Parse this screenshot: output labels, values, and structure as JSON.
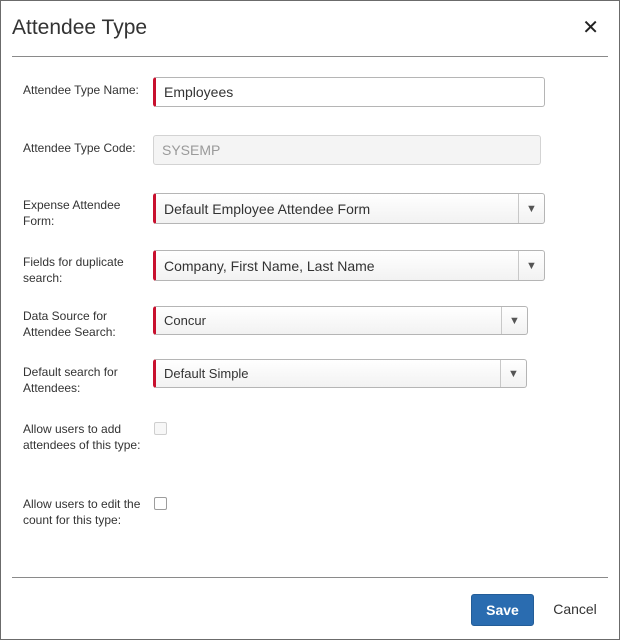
{
  "dialog": {
    "title": "Attendee Type",
    "close_icon": "close-icon",
    "close_glyph": "✕"
  },
  "form": {
    "name_label": "Attendee Type Name:",
    "name_value": "Employees",
    "code_label": "Attendee Type Code:",
    "code_value": "SYSEMP",
    "expense_form_label": "Expense Attendee Form:",
    "expense_form_value": "Default Employee Attendee Form",
    "duplicate_label": "Fields for duplicate search:",
    "duplicate_value": "Company, First Name, Last Name",
    "data_source_label": "Data Source for Attendee Search:",
    "data_source_value": "Concur",
    "default_search_label": "Default search for Attendees:",
    "default_search_value": "Default Simple",
    "allow_add_label": "Allow users to add attendees of this type:",
    "allow_add_checked": false,
    "allow_edit_label": "Allow users to edit the count for this type:",
    "allow_edit_checked": false
  },
  "footer": {
    "save_label": "Save",
    "cancel_label": "Cancel"
  },
  "colors": {
    "required_marker": "#c8102e",
    "primary_button": "#2a6cb0"
  }
}
